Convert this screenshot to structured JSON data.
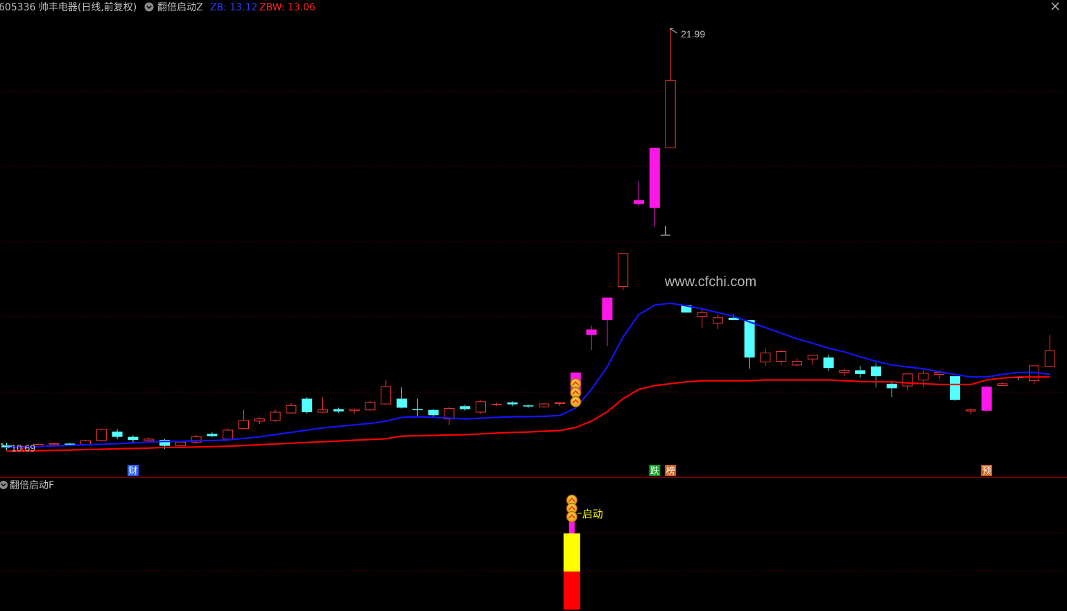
{
  "header": {
    "title": "605336 帅丰电器(日线,前复权)",
    "indicator": "翻倍启动Z",
    "zb_label": "ZB: 13.12",
    "zbw_label": "ZBW: 13.06"
  },
  "sub_header": {
    "indicator": "翻倍启动F"
  },
  "close_icon": "close-icon",
  "watermark": "www.cfchi.com",
  "colors": {
    "up": "#ff3838",
    "down": "#54ffff",
    "surge": "#ff17e9",
    "zb_line": "#1414ff",
    "zbw_line": "#ff0000",
    "grid": "#7a0000",
    "divider": "#b40000",
    "text": "#c0c0c0",
    "signal_yellow": "#ffff00",
    "signal_red": "#ff0000",
    "signal_magenta": "#ff17e9",
    "coin": "#ffb400"
  },
  "chart_data": [
    {
      "type": "candlestick",
      "panel": "main",
      "ylim": [
        10.0,
        22.75
      ],
      "grid": "horizontal dotted",
      "annotations": {
        "high_label": "21.99",
        "low_label": "10.69",
        "cross_marker": "⊥"
      },
      "series": [
        {
          "name": "ZB",
          "values": [
            10.8,
            10.8,
            10.82,
            10.84,
            10.85,
            10.87,
            10.88,
            10.9,
            10.92,
            10.94,
            10.96,
            10.96,
            10.98,
            10.98,
            11.0,
            11.04,
            11.08,
            11.14,
            11.2,
            11.26,
            11.32,
            11.36,
            11.4,
            11.44,
            11.5,
            11.6,
            11.62,
            11.6,
            11.58,
            11.56,
            11.58,
            11.6,
            11.62,
            11.62,
            11.63,
            11.65,
            11.85,
            12.35,
            12.95,
            13.75,
            14.35,
            14.6,
            14.65,
            14.58,
            14.5,
            14.4,
            14.3,
            14.15,
            14.0,
            13.85,
            13.7,
            13.58,
            13.45,
            13.35,
            13.22,
            13.1,
            13.0,
            12.95,
            12.9,
            12.82,
            12.75,
            12.68,
            12.68,
            12.75,
            12.8,
            12.8,
            12.75
          ]
        },
        {
          "name": "ZBW",
          "values": [
            10.7,
            10.7,
            10.71,
            10.72,
            10.73,
            10.74,
            10.75,
            10.76,
            10.77,
            10.78,
            10.8,
            10.8,
            10.81,
            10.82,
            10.83,
            10.85,
            10.87,
            10.89,
            10.91,
            10.93,
            10.95,
            10.97,
            10.99,
            11.01,
            11.03,
            11.1,
            11.11,
            11.12,
            11.13,
            11.14,
            11.16,
            11.18,
            11.2,
            11.21,
            11.23,
            11.25,
            11.33,
            11.5,
            11.75,
            12.1,
            12.35,
            12.45,
            12.5,
            12.55,
            12.58,
            12.58,
            12.58,
            12.58,
            12.6,
            12.6,
            12.6,
            12.6,
            12.6,
            12.58,
            12.56,
            12.55,
            12.55,
            12.52,
            12.5,
            12.48,
            12.48,
            12.48,
            12.6,
            12.65,
            12.68,
            12.68,
            12.68
          ]
        }
      ],
      "candles": [
        [
          10.85,
          10.92,
          10.72,
          10.8
        ],
        [
          10.78,
          10.85,
          10.7,
          10.82
        ],
        [
          10.82,
          10.9,
          10.8,
          10.88
        ],
        [
          10.88,
          10.92,
          10.82,
          10.9
        ],
        [
          10.9,
          10.92,
          10.85,
          10.88
        ],
        [
          10.88,
          11.0,
          10.86,
          10.98
        ],
        [
          10.98,
          11.3,
          10.96,
          11.28
        ],
        [
          11.22,
          11.28,
          11.02,
          11.08
        ],
        [
          11.08,
          11.12,
          10.9,
          11.0
        ],
        [
          10.98,
          11.06,
          10.92,
          11.02
        ],
        [
          11.0,
          11.02,
          10.76,
          10.84
        ],
        [
          10.84,
          10.98,
          10.82,
          10.94
        ],
        [
          10.94,
          11.12,
          10.9,
          11.08
        ],
        [
          11.16,
          11.2,
          11.08,
          11.1
        ],
        [
          11.02,
          11.3,
          11.0,
          11.26
        ],
        [
          11.3,
          11.8,
          11.28,
          11.52
        ],
        [
          11.5,
          11.6,
          11.42,
          11.56
        ],
        [
          11.52,
          11.8,
          11.48,
          11.74
        ],
        [
          11.72,
          11.98,
          11.7,
          11.92
        ],
        [
          12.1,
          12.14,
          11.7,
          11.74
        ],
        [
          11.74,
          12.14,
          11.72,
          11.8
        ],
        [
          11.82,
          11.86,
          11.72,
          11.76
        ],
        [
          11.78,
          11.84,
          11.7,
          11.82
        ],
        [
          11.8,
          12.04,
          11.78,
          12.0
        ],
        [
          11.96,
          12.6,
          11.94,
          12.42
        ],
        [
          12.1,
          12.4,
          11.84,
          11.86
        ],
        [
          11.82,
          12.1,
          11.62,
          11.8
        ],
        [
          11.8,
          11.82,
          11.6,
          11.66
        ],
        [
          11.56,
          11.88,
          11.4,
          11.84
        ],
        [
          11.9,
          11.94,
          11.78,
          11.82
        ],
        [
          11.74,
          12.06,
          11.7,
          12.02
        ],
        [
          11.96,
          12.0,
          11.9,
          11.96
        ],
        [
          12.0,
          12.03,
          11.9,
          11.95
        ],
        [
          11.92,
          11.94,
          11.86,
          11.9
        ],
        [
          11.88,
          11.99,
          11.86,
          11.96
        ],
        [
          11.98,
          12.02,
          11.9,
          12.0
        ],
        [
          12.2,
          12.8,
          12.18,
          12.8
        ],
        [
          13.8,
          14.05,
          13.4,
          13.95
        ],
        [
          14.2,
          14.8,
          13.5,
          14.8
        ],
        [
          15.1,
          15.98,
          15.0,
          15.98
        ],
        [
          17.3,
          17.9,
          17.25,
          17.4
        ],
        [
          18.8,
          18.8,
          16.7,
          17.2
        ],
        [
          18.8,
          21.99,
          18.8,
          20.6
        ],
        [
          14.6,
          14.6,
          14.4,
          14.4
        ],
        [
          14.3,
          14.5,
          14.0,
          14.4
        ],
        [
          14.12,
          14.36,
          13.96,
          14.26
        ],
        [
          14.26,
          14.36,
          14.2,
          14.2
        ],
        [
          14.2,
          14.2,
          12.9,
          13.2
        ],
        [
          13.08,
          13.44,
          12.98,
          13.32
        ],
        [
          13.1,
          13.4,
          13.0,
          13.36
        ],
        [
          13.0,
          13.18,
          12.96,
          13.1
        ],
        [
          13.16,
          13.26,
          13.0,
          13.26
        ],
        [
          13.2,
          13.28,
          12.84,
          12.92
        ],
        [
          12.8,
          12.9,
          12.7,
          12.86
        ],
        [
          12.86,
          12.98,
          12.66,
          12.76
        ],
        [
          12.96,
          13.06,
          12.4,
          12.7
        ],
        [
          12.5,
          12.58,
          12.14,
          12.38
        ],
        [
          12.44,
          12.78,
          12.32,
          12.76
        ],
        [
          12.6,
          12.86,
          12.4,
          12.78
        ],
        [
          12.75,
          12.86,
          12.62,
          12.8
        ],
        [
          12.7,
          12.7,
          12.04,
          12.07
        ],
        [
          11.78,
          11.84,
          11.68,
          11.8
        ],
        [
          11.78,
          12.44,
          11.76,
          12.42
        ],
        [
          12.45,
          12.55,
          12.44,
          12.5
        ],
        [
          12.68,
          12.69,
          12.6,
          12.66
        ],
        [
          12.58,
          12.96,
          12.48,
          12.98
        ],
        [
          12.96,
          13.8,
          12.95,
          13.38
        ]
      ],
      "event_tags": [
        {
          "text": "财",
          "color": "#2a60ff",
          "index": 8
        },
        {
          "text": "跌",
          "color": "#10a020",
          "index": 41
        },
        {
          "text": "榜",
          "color": "#d06018",
          "index": 42
        },
        {
          "text": "预",
          "color": "#d06018",
          "index": 62
        }
      ],
      "buy_signal_index": 36
    },
    {
      "type": "bar",
      "panel": "indicator",
      "ylim": [
        0,
        3
      ],
      "signal_index": 36,
      "stacked_values": [
        {
          "name": "red",
          "value": 1.0
        },
        {
          "name": "yellow",
          "value": 1.0
        },
        {
          "name": "magenta",
          "value": 0.98
        }
      ],
      "signal_label": "启动"
    }
  ]
}
